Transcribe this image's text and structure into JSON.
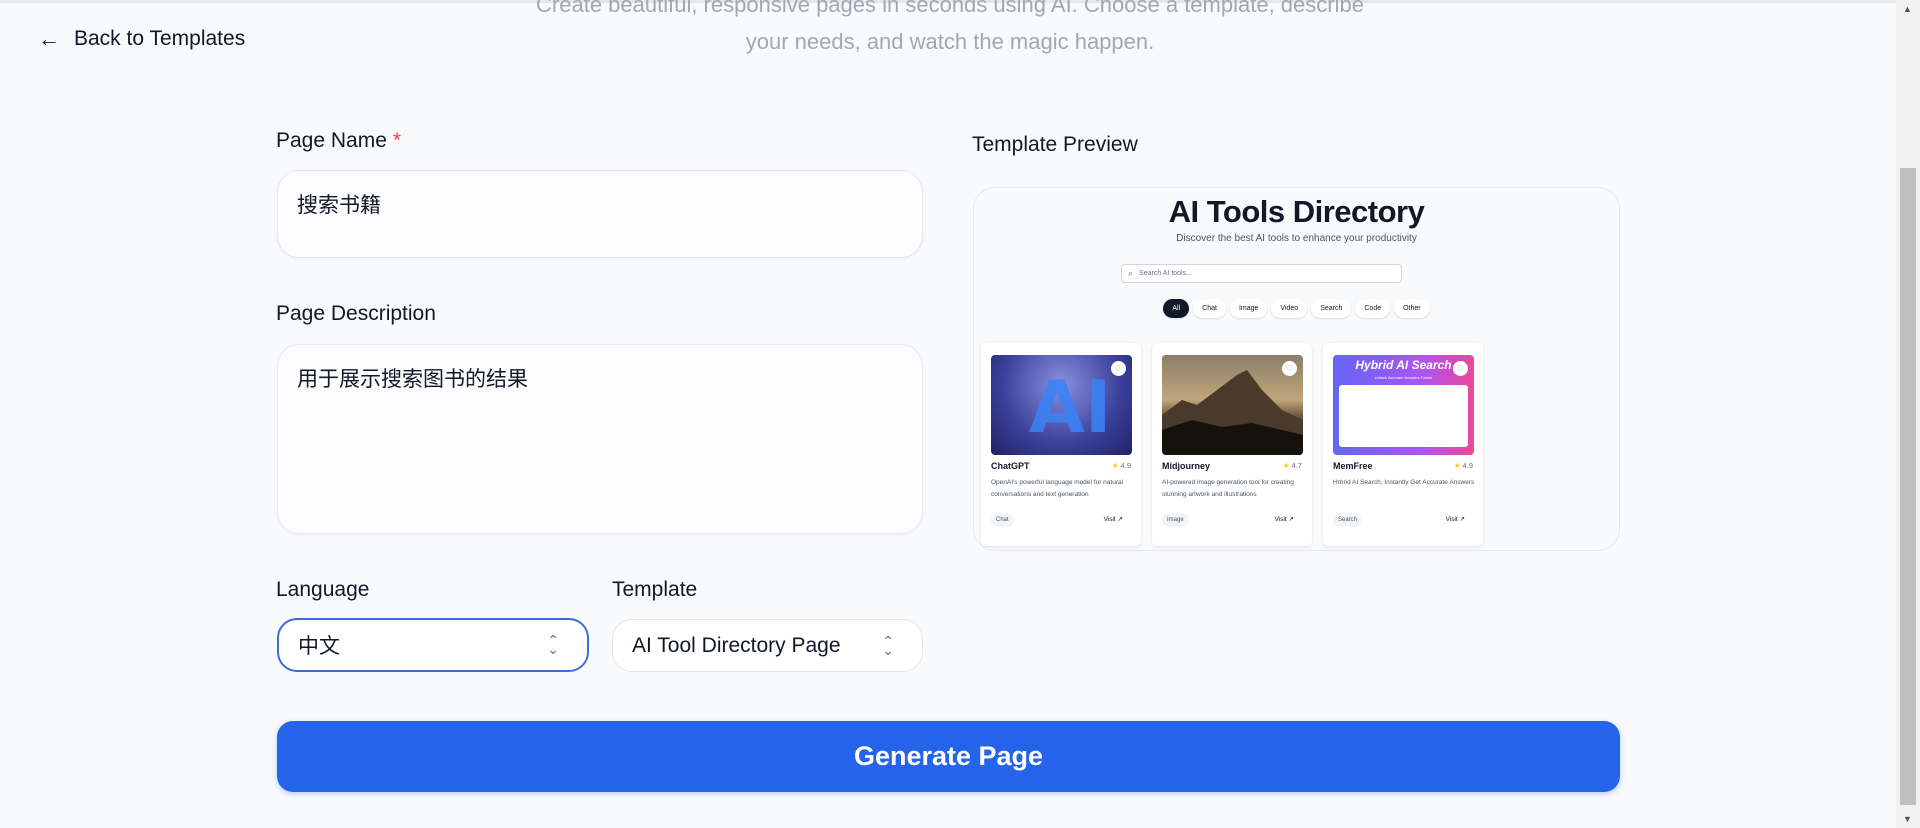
{
  "nav": {
    "back_label": "Back to Templates"
  },
  "header": {
    "subtitle_line1": "Create beautiful, responsive pages in seconds using AI. Choose a template, describe",
    "subtitle_line2": "your needs, and watch the magic happen."
  },
  "form": {
    "page_name": {
      "label": "Page Name",
      "required_mark": "*",
      "value": "搜索书籍"
    },
    "page_description": {
      "label": "Page Description",
      "value": "用于展示搜索图书的结果"
    },
    "language": {
      "label": "Language",
      "value": "中文"
    },
    "template": {
      "label": "Template",
      "value": "AI Tool Directory Page"
    },
    "generate_label": "Generate Page"
  },
  "preview": {
    "label": "Template Preview",
    "title": "AI Tools Directory",
    "subtitle": "Discover the best AI tools to enhance your productivity",
    "search_placeholder": "Search AI tools...",
    "filters": [
      "All",
      "Chat",
      "Image",
      "Video",
      "Search",
      "Code",
      "Other"
    ],
    "active_filter": "All",
    "cards": [
      {
        "name": "ChatGPT",
        "rating": "4.9",
        "description": "OpenAI's powerful language model for natural conversations and text generation",
        "tag": "Chat",
        "visit": "Visit ↗"
      },
      {
        "name": "Midjourney",
        "rating": "4.7",
        "description": "AI-powered image generation tool for creating stunning artwork and illustrations",
        "tag": "Image",
        "visit": "Visit ↗"
      },
      {
        "name": "MemFree",
        "rating": "4.9",
        "description": "Hrbrid AI Search, Instantly Get Accurate Answers",
        "tag": "Search",
        "visit": "Visit ↗",
        "image_text": "Hybrid AI Search",
        "image_subtext": "Unlock Accurate Answers Faster"
      }
    ]
  },
  "colors": {
    "primary": "#2563eb",
    "required": "#ef4444",
    "focus_border": "#3b6fd6"
  }
}
